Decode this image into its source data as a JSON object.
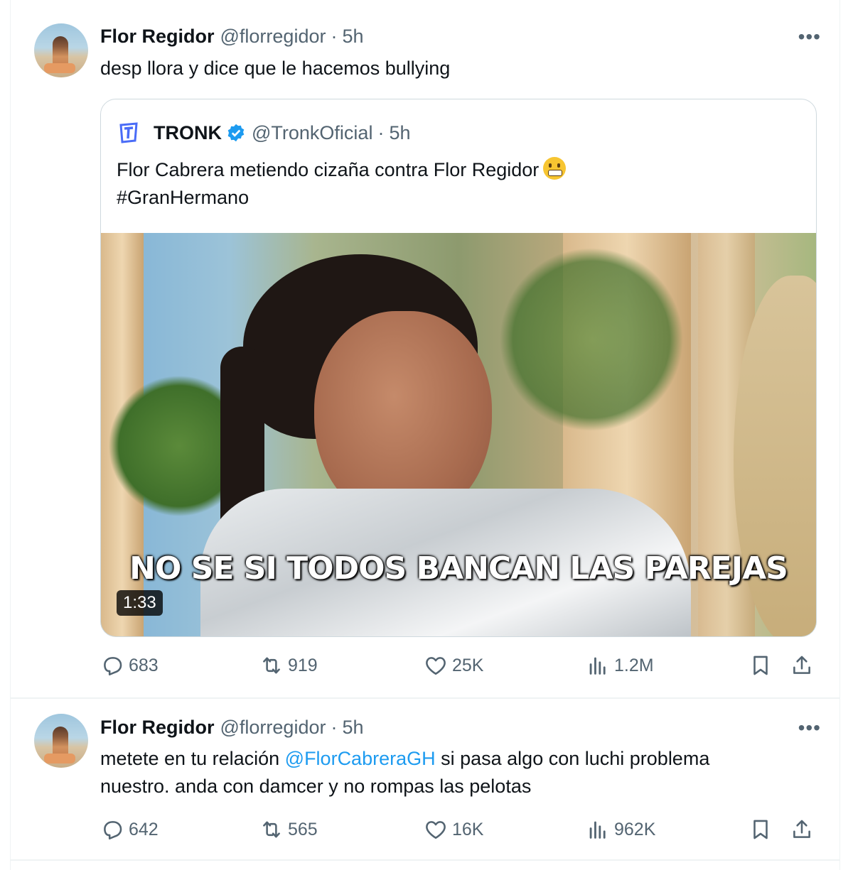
{
  "tweets": [
    {
      "author_name": "Flor Regidor",
      "author_handle": "@florregidor",
      "separator": "·",
      "time": "5h",
      "more_label": "•••",
      "text": "desp llora y dice que le hacemos bullying",
      "quote": {
        "author_name": "TRONK",
        "author_handle": "@TronkOficial",
        "separator": "·",
        "time": "5h",
        "text_line1": "Flor Cabrera metiendo cizaña contra Flor Regidor",
        "text_line2": "#GranHermano",
        "video_caption": "NO SE SI TODOS BANCAN LAS PAREJAS",
        "video_duration": "1:33"
      },
      "stats": {
        "replies": "683",
        "reposts": "919",
        "likes": "25K",
        "views": "1.2M"
      }
    },
    {
      "author_name": "Flor Regidor",
      "author_handle": "@florregidor",
      "separator": "·",
      "time": "5h",
      "more_label": "•••",
      "text_part1": "metete en tu relación ",
      "mention": "@FlorCabreraGH",
      "text_part2": " si pasa algo con luchi problema",
      "text_line2": "nuestro. anda con damcer y no rompas las pelotas",
      "stats": {
        "replies": "642",
        "reposts": "565",
        "likes": "16K",
        "views": "962K"
      }
    }
  ],
  "icons": {
    "reply": "reply-icon",
    "repost": "repost-icon",
    "like": "heart-icon",
    "views": "views-icon",
    "bookmark": "bookmark-icon",
    "share": "share-icon",
    "verified": "verified-badge-icon"
  },
  "colors": {
    "text": "#0f1419",
    "muted": "#536471",
    "accent": "#1d9bf0",
    "border": "#cfd9de"
  }
}
